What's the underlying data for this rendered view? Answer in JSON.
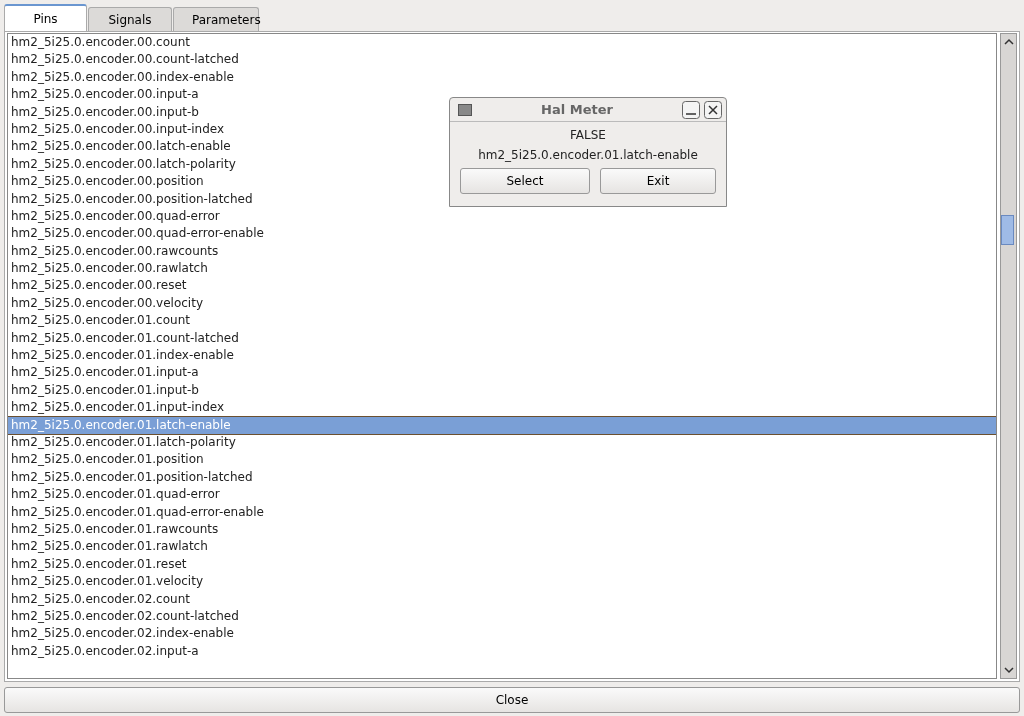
{
  "tabs": [
    {
      "label": "Pins",
      "selected": true
    },
    {
      "label": "Signals",
      "selected": false
    },
    {
      "label": "Parameters",
      "selected": false
    }
  ],
  "pins": [
    {
      "name": "hm2_5i25.0.encoder.00.count",
      "selected": false
    },
    {
      "name": "hm2_5i25.0.encoder.00.count-latched",
      "selected": false
    },
    {
      "name": "hm2_5i25.0.encoder.00.index-enable",
      "selected": false
    },
    {
      "name": "hm2_5i25.0.encoder.00.input-a",
      "selected": false
    },
    {
      "name": "hm2_5i25.0.encoder.00.input-b",
      "selected": false
    },
    {
      "name": "hm2_5i25.0.encoder.00.input-index",
      "selected": false
    },
    {
      "name": "hm2_5i25.0.encoder.00.latch-enable",
      "selected": false
    },
    {
      "name": "hm2_5i25.0.encoder.00.latch-polarity",
      "selected": false
    },
    {
      "name": "hm2_5i25.0.encoder.00.position",
      "selected": false
    },
    {
      "name": "hm2_5i25.0.encoder.00.position-latched",
      "selected": false
    },
    {
      "name": "hm2_5i25.0.encoder.00.quad-error",
      "selected": false
    },
    {
      "name": "hm2_5i25.0.encoder.00.quad-error-enable",
      "selected": false
    },
    {
      "name": "hm2_5i25.0.encoder.00.rawcounts",
      "selected": false
    },
    {
      "name": "hm2_5i25.0.encoder.00.rawlatch",
      "selected": false
    },
    {
      "name": "hm2_5i25.0.encoder.00.reset",
      "selected": false
    },
    {
      "name": "hm2_5i25.0.encoder.00.velocity",
      "selected": false
    },
    {
      "name": "hm2_5i25.0.encoder.01.count",
      "selected": false
    },
    {
      "name": "hm2_5i25.0.encoder.01.count-latched",
      "selected": false
    },
    {
      "name": "hm2_5i25.0.encoder.01.index-enable",
      "selected": false
    },
    {
      "name": "hm2_5i25.0.encoder.01.input-a",
      "selected": false
    },
    {
      "name": "hm2_5i25.0.encoder.01.input-b",
      "selected": false
    },
    {
      "name": "hm2_5i25.0.encoder.01.input-index",
      "selected": false
    },
    {
      "name": "hm2_5i25.0.encoder.01.latch-enable",
      "selected": true
    },
    {
      "name": "hm2_5i25.0.encoder.01.latch-polarity",
      "selected": false
    },
    {
      "name": "hm2_5i25.0.encoder.01.position",
      "selected": false
    },
    {
      "name": "hm2_5i25.0.encoder.01.position-latched",
      "selected": false
    },
    {
      "name": "hm2_5i25.0.encoder.01.quad-error",
      "selected": false
    },
    {
      "name": "hm2_5i25.0.encoder.01.quad-error-enable",
      "selected": false
    },
    {
      "name": "hm2_5i25.0.encoder.01.rawcounts",
      "selected": false
    },
    {
      "name": "hm2_5i25.0.encoder.01.rawlatch",
      "selected": false
    },
    {
      "name": "hm2_5i25.0.encoder.01.reset",
      "selected": false
    },
    {
      "name": "hm2_5i25.0.encoder.01.velocity",
      "selected": false
    },
    {
      "name": "hm2_5i25.0.encoder.02.count",
      "selected": false
    },
    {
      "name": "hm2_5i25.0.encoder.02.count-latched",
      "selected": false
    },
    {
      "name": "hm2_5i25.0.encoder.02.index-enable",
      "selected": false
    },
    {
      "name": "hm2_5i25.0.encoder.02.input-a",
      "selected": false
    }
  ],
  "close_button": "Close",
  "dialog": {
    "title": "Hal Meter",
    "value": "FALSE",
    "pin": "hm2_5i25.0.encoder.01.latch-enable",
    "buttons": [
      "Select",
      "Exit"
    ]
  }
}
